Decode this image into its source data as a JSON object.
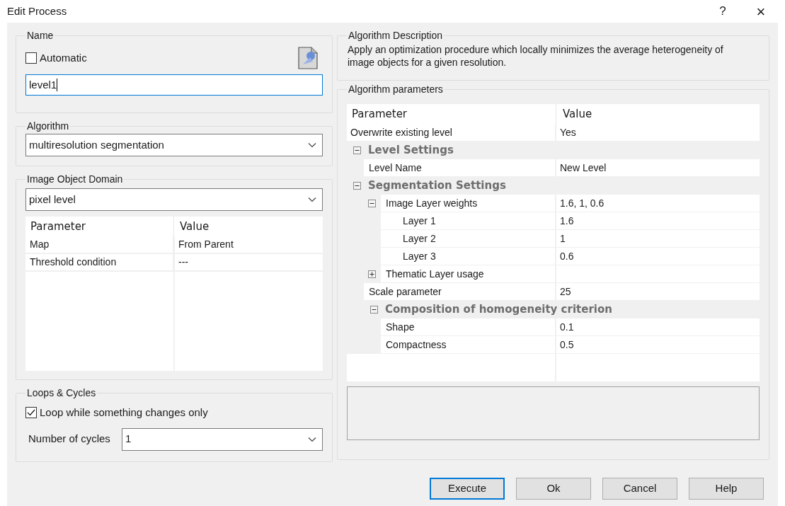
{
  "window": {
    "title": "Edit Process",
    "help_button": "?",
    "close_button": "×"
  },
  "name_group": {
    "legend": "Name",
    "automatic": {
      "label": "Automatic",
      "checked": false
    },
    "value": "level1"
  },
  "algorithm_group": {
    "legend": "Algorithm",
    "value": "multiresolution segmentation"
  },
  "domain_group": {
    "legend": "Image Object Domain",
    "value": "pixel level",
    "columns": [
      "Parameter",
      "Value"
    ],
    "rows": [
      {
        "parameter": "Map",
        "value": "From Parent"
      },
      {
        "parameter": "Threshold condition",
        "value": "---"
      }
    ]
  },
  "loops_group": {
    "legend": "Loops & Cycles",
    "loop_option": {
      "label": "Loop while something changes only",
      "checked": true
    },
    "cycles_label": "Number of cycles",
    "cycles_value": "1"
  },
  "description_group": {
    "legend": "Algorithm Description",
    "text": "Apply an optimization procedure which locally minimizes the average heterogeneity of image objects for a given resolution."
  },
  "parameters_group": {
    "legend": "Algorithm parameters",
    "columns": [
      "Parameter",
      "Value"
    ],
    "rows": [
      {
        "kind": "property",
        "name": "Overwrite existing level",
        "value": "Yes"
      },
      {
        "kind": "category",
        "name": "Level Settings",
        "expanded": true,
        "children": [
          {
            "kind": "property",
            "name": "Level Name",
            "value": "New Level"
          }
        ]
      },
      {
        "kind": "category",
        "name": "Segmentation Settings",
        "expanded": true,
        "children": [
          {
            "kind": "group",
            "name": "Image Layer weights",
            "value": "1.6, 1, 0.6",
            "expanded": true,
            "children": [
              {
                "kind": "property",
                "name": "Layer 1",
                "value": "1.6"
              },
              {
                "kind": "property",
                "name": "Layer 2",
                "value": "1"
              },
              {
                "kind": "property",
                "name": "Layer 3",
                "value": "0.6"
              }
            ]
          },
          {
            "kind": "group",
            "name": "Thematic Layer usage",
            "expanded": false
          },
          {
            "kind": "property",
            "name": "Scale parameter",
            "value": "25"
          },
          {
            "kind": "category",
            "name": "Composition of homogeneity criterion",
            "expanded": true,
            "children": [
              {
                "kind": "property",
                "name": "Shape",
                "value": "0.1"
              },
              {
                "kind": "property",
                "name": "Compactness",
                "value": "0.5"
              }
            ]
          }
        ]
      }
    ]
  },
  "buttons": [
    {
      "label": "Execute",
      "default": true
    },
    {
      "label": "Ok",
      "default": false
    },
    {
      "label": "Cancel",
      "default": false
    },
    {
      "label": "Help",
      "default": false
    }
  ]
}
